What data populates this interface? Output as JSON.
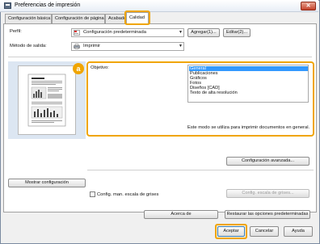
{
  "window": {
    "title": "Preferencias de impresión",
    "close_label": "✕"
  },
  "tabs": [
    {
      "label": "Configuración básica"
    },
    {
      "label": "Configuración de página"
    },
    {
      "label": "Acabado"
    },
    {
      "label": "Calidad"
    }
  ],
  "profile": {
    "label": "Perfil:",
    "value": "Configuración predeterminada",
    "add_button": "Agregar(1)...",
    "edit_button": "Editar(2)..."
  },
  "output": {
    "label": "Método de salida:",
    "value": "Imprimir"
  },
  "callout": {
    "label": "a"
  },
  "objective": {
    "label": "Objetivo:",
    "items": [
      "General",
      "Publicaciones",
      "Gráficos",
      "Fotos",
      "Diseños [CAD]",
      "Texto de alta resolución"
    ],
    "selected_index": 0,
    "description": "Este modo se utiliza para imprimir documentos en general."
  },
  "buttons": {
    "advanced": "Configuración avanzada...",
    "show_settings": "Mostrar configuración",
    "grayscale_settings": "Config. escala de grises...",
    "about": "Acerca de",
    "restore_defaults": "Restaurar las opciones predeterminadas",
    "ok": "Aceptar",
    "cancel": "Cancelar",
    "help": "Ayuda"
  },
  "grayscale": {
    "checkbox_label": "Config. man. escala de grises",
    "checked": false
  },
  "colors": {
    "accent": "#f0a500",
    "selection": "#3399ff"
  }
}
